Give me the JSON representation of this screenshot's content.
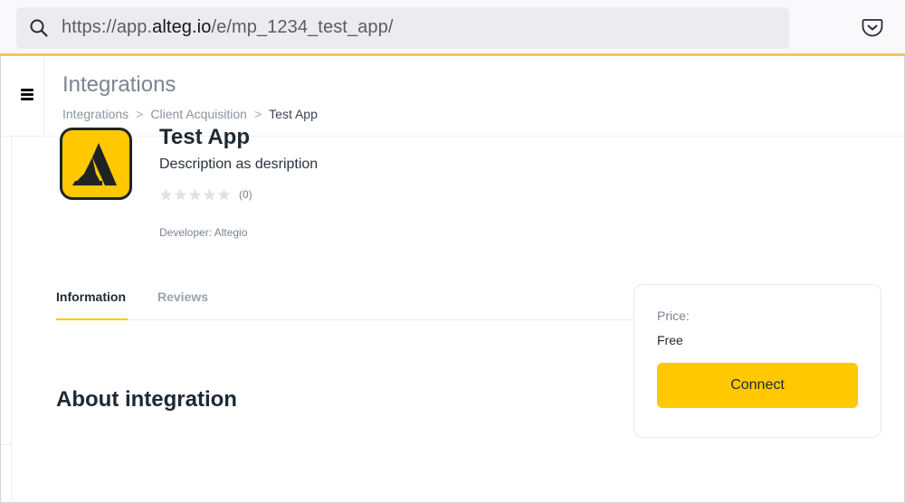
{
  "browser": {
    "url_prefix": "https://app.",
    "url_domain": "alteg.io",
    "url_path": "/e/mp_1234_test_app/"
  },
  "header": {
    "title": "Integrations",
    "breadcrumb": [
      "Integrations",
      "Client Acquisition",
      "Test App"
    ],
    "separator": ">"
  },
  "app": {
    "name": "Test App",
    "description": "Description as desription",
    "rating_stars": 0,
    "rating_max": 5,
    "rating_count": "(0)",
    "developer": "Developer: Altegio",
    "logo_color": "#ffc800"
  },
  "tabs": [
    {
      "label": "Information",
      "active": true
    },
    {
      "label": "Reviews",
      "active": false
    }
  ],
  "section": {
    "title": "About integration"
  },
  "pricing": {
    "label": "Price:",
    "value": "Free",
    "button_label": "Connect"
  },
  "colors": {
    "accent": "#ffc800",
    "browser_accent": "#f7c16b"
  }
}
